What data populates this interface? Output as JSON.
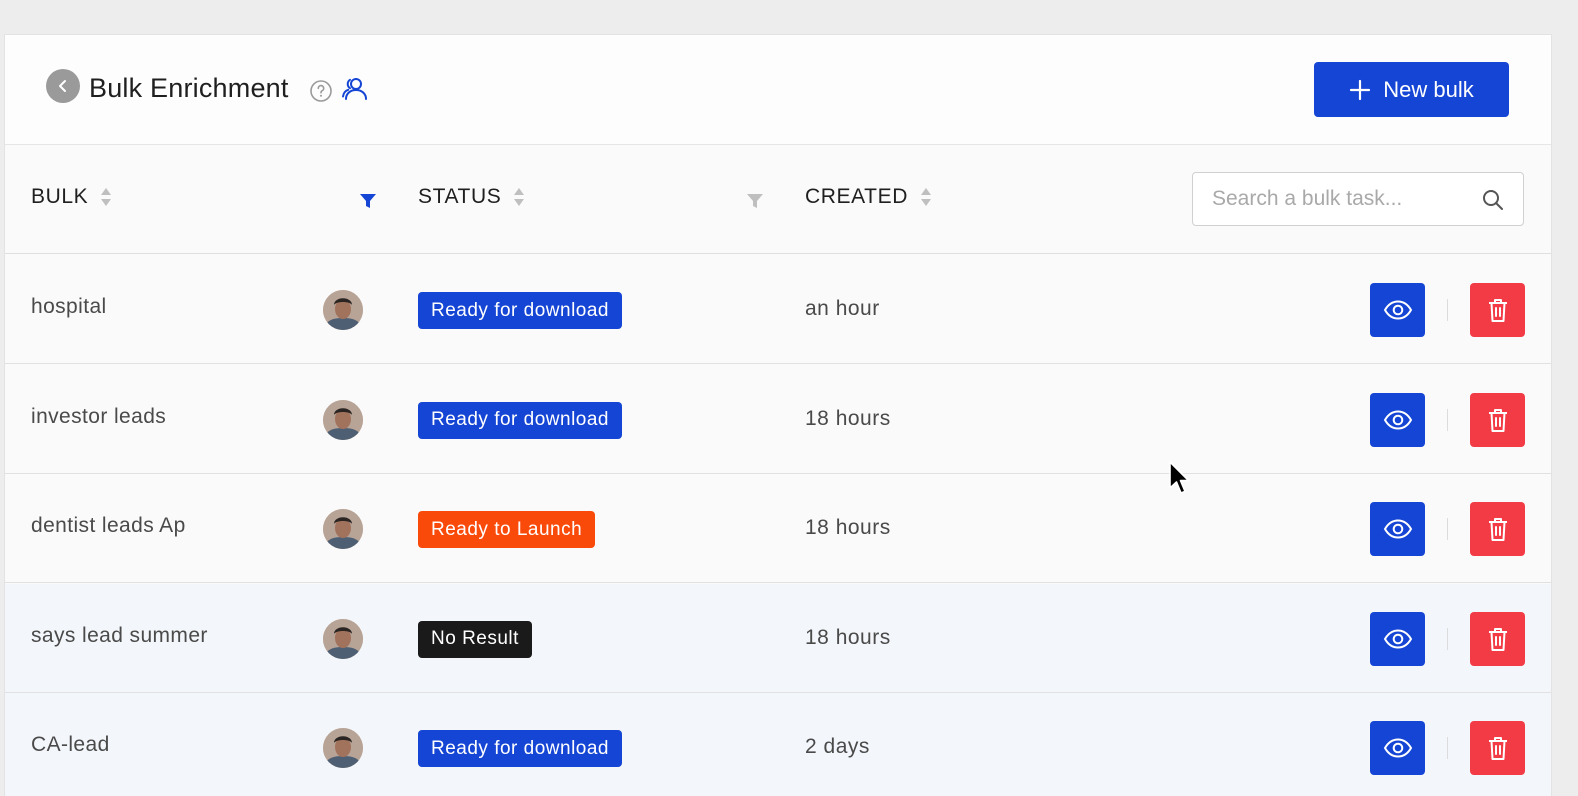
{
  "header": {
    "title": "Bulk Enrichment",
    "new_button_label": "New bulk"
  },
  "table": {
    "columns": [
      "BULK",
      "STATUS",
      "CREATED"
    ],
    "search_placeholder": "Search a bulk task...",
    "rows": [
      {
        "name": "hospital",
        "status": "Ready for download",
        "status_color": "#1545d4",
        "created": "an hour"
      },
      {
        "name": "investor leads",
        "status": "Ready for download",
        "status_color": "#1545d4",
        "created": "18 hours"
      },
      {
        "name": "dentist leads Ap",
        "status": "Ready to Launch",
        "status_color": "#fa4a0a",
        "created": "18 hours"
      },
      {
        "name": "says lead summer",
        "status": "No Result",
        "status_color": "#1a1a1a",
        "created": "18 hours"
      },
      {
        "name": "CA-lead",
        "status": "Ready for download",
        "status_color": "#1545d4",
        "created": "2 days"
      }
    ]
  },
  "colors": {
    "primary": "#1545d4",
    "danger": "#f23b45",
    "warning": "#fa4a0a",
    "dark": "#1a1a1a"
  },
  "icons": {
    "back": "chevron-left-icon",
    "help": "question-circle-icon",
    "team": "users-icon",
    "add": "plus-icon",
    "search": "search-icon",
    "view": "eye-icon",
    "delete": "trash-icon",
    "filter": "filter-icon"
  }
}
